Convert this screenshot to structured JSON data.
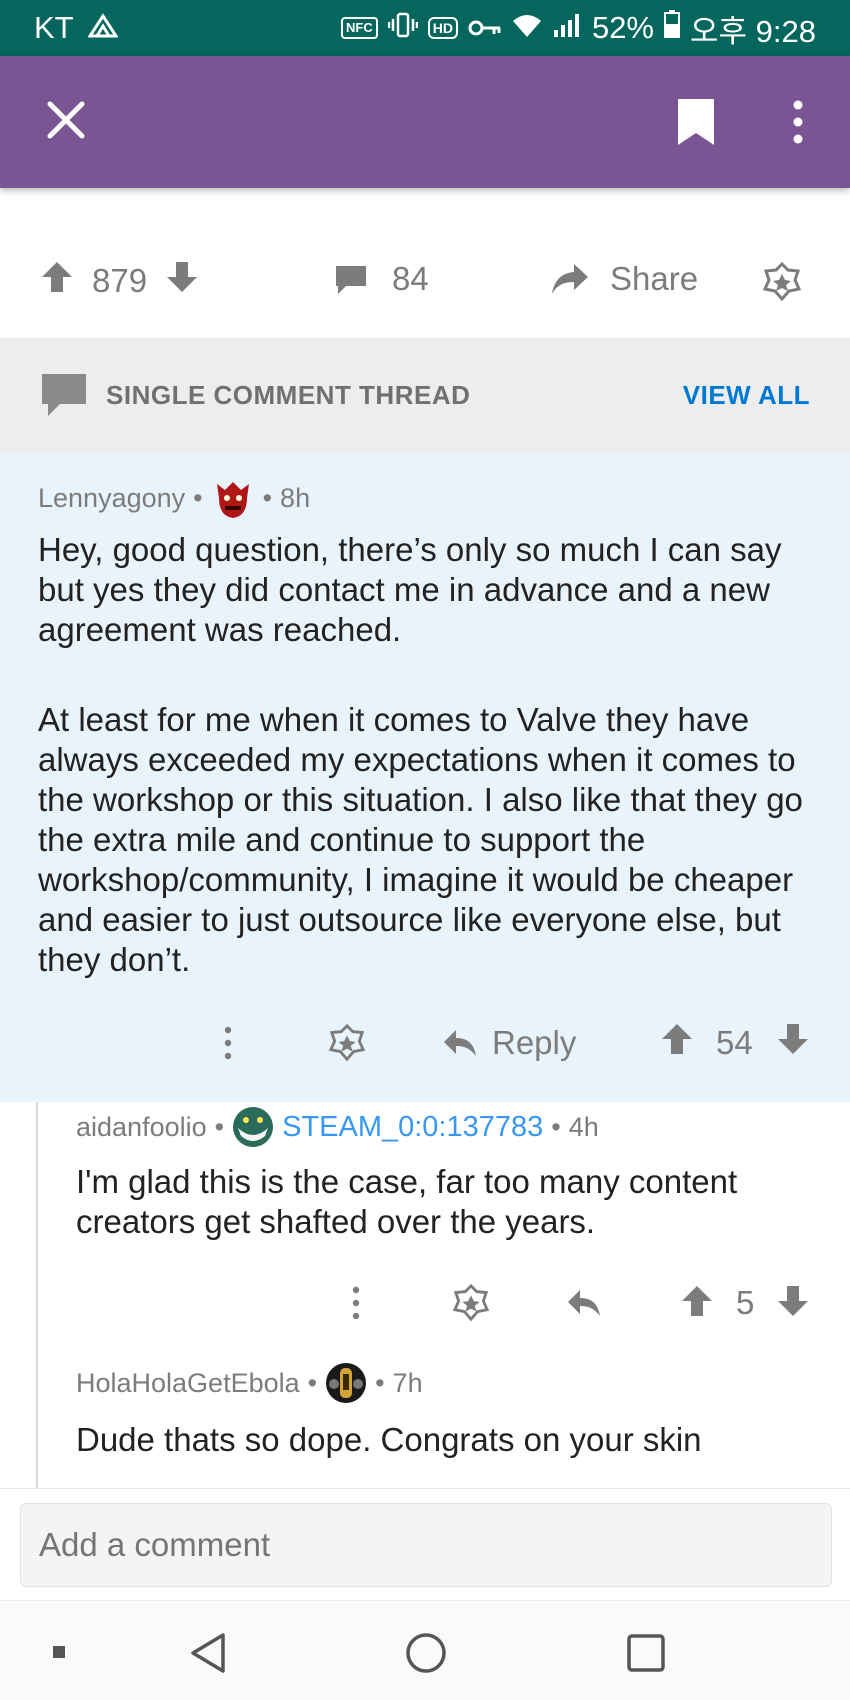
{
  "status_bar": {
    "carrier": "KT",
    "chips": [
      "NFC",
      "HD"
    ],
    "battery": "52%",
    "time": "오후 9:28"
  },
  "app_bar": {
    "close_icon": "close-icon",
    "bookmark_icon": "bookmark-icon",
    "more_icon": "more-vertical-icon"
  },
  "post_actions": {
    "score": "879",
    "comments": "84",
    "share_label": "Share"
  },
  "thread_banner": {
    "label": "SINGLE COMMENT THREAD",
    "view_all": "VIEW ALL"
  },
  "comments": [
    {
      "author": "Lennyagony",
      "age": "8h",
      "body": [
        "Hey, good question, there’s only so much I can say but yes they did contact me in advance and a new agreement was reached.",
        "At least for me when it comes to Valve they have always exceeded my expectations when it comes to the workshop or this situation. I also like that they go the extra mile and continue to support the workshop/community, I imagine it would be cheaper and easier to just outsource like everyone else, but they don’t."
      ],
      "reply_label": "Reply",
      "score": "54"
    },
    {
      "author": "aidanfoolio",
      "flair": "STEAM_0:0:137783",
      "age": "4h",
      "body": "I'm glad this is the case, far too many content creators get shafted over the years.",
      "score": "5"
    },
    {
      "author": "HolaHolaGetEbola",
      "age": "7h",
      "body": "Dude thats so dope. Congrats on your skin"
    }
  ],
  "add_comment": {
    "placeholder": "Add a comment"
  },
  "colors": {
    "status_bar": "#04665c",
    "app_bar": "#7a5593",
    "highlight": "#e8f3fb",
    "link": "#0079d3",
    "flair": "#3897f0"
  }
}
